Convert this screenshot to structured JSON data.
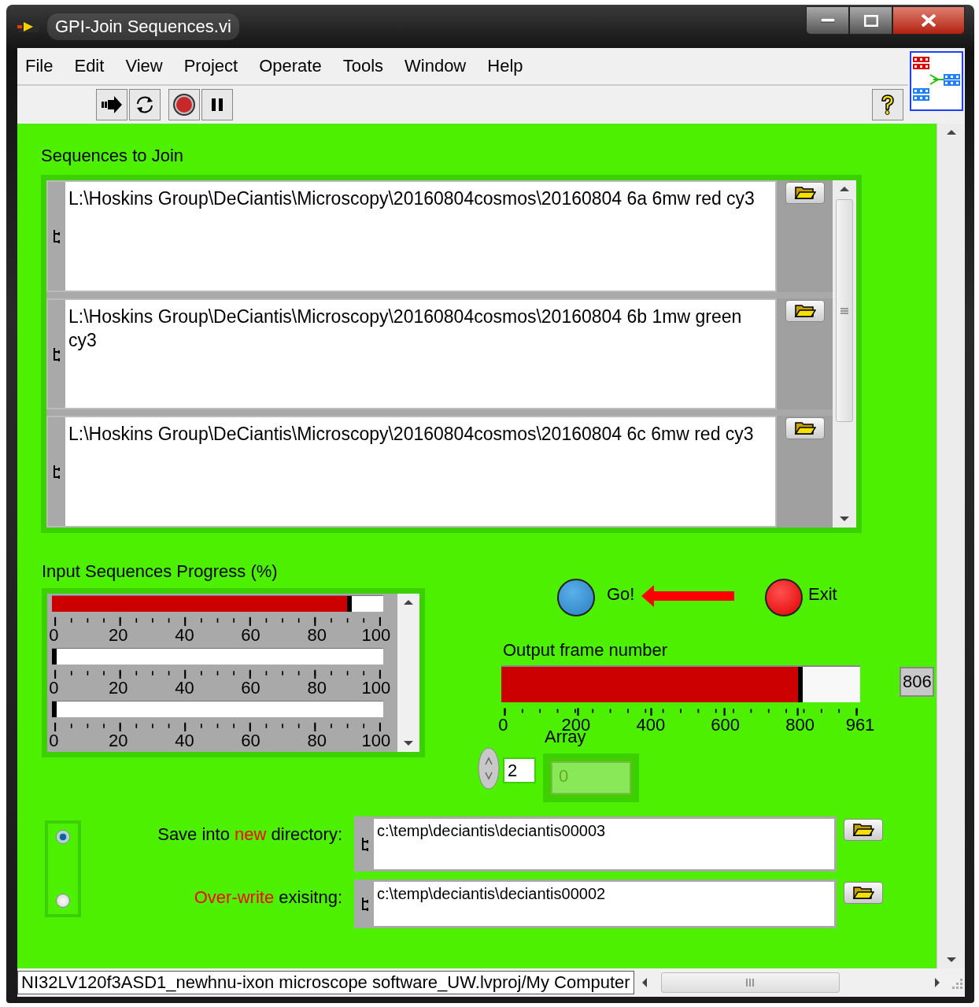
{
  "window": {
    "title": "GPI-Join Sequences.vi"
  },
  "menu": [
    {
      "label": "File"
    },
    {
      "label": "Edit"
    },
    {
      "label": "View"
    },
    {
      "label": "Project"
    },
    {
      "label": "Operate"
    },
    {
      "label": "Tools"
    },
    {
      "label": "Window"
    },
    {
      "label": "Help"
    }
  ],
  "sequences": {
    "label": "Sequences to Join",
    "items": [
      {
        "path": "L:\\Hoskins Group\\DeCiantis\\Microscopy\\20160804cosmos\\20160804 6a 6mw red cy3"
      },
      {
        "path": "L:\\Hoskins Group\\DeCiantis\\Microscopy\\20160804cosmos\\20160804 6b 1mw green cy3"
      },
      {
        "path": "L:\\Hoskins Group\\DeCiantis\\Microscopy\\20160804cosmos\\20160804 6c 6mw red cy3"
      }
    ]
  },
  "progress": {
    "label": "Input Sequences Progress (%)",
    "bars": [
      {
        "level": 0.89,
        "scale": [
          "0",
          "20",
          "40",
          "60",
          "80",
          "100"
        ]
      },
      {
        "level": 0,
        "scale": [
          "0",
          "20",
          "40",
          "60",
          "80",
          "100"
        ]
      },
      {
        "level": 0,
        "scale": [
          "0",
          "20",
          "40",
          "60",
          "80",
          "100"
        ]
      }
    ]
  },
  "go_button": {
    "label": "Go!"
  },
  "exit_button": {
    "label": "Exit"
  },
  "output_frame": {
    "label": "Output frame number",
    "level": 0.839,
    "scale": [
      "0",
      "200",
      "400",
      "600",
      "800",
      "961"
    ],
    "value": "806"
  },
  "array": {
    "label": "Array",
    "index": "2",
    "element": "0",
    "disabled": true
  },
  "destination": {
    "options": [
      {
        "label_parts": [
          {
            "text": "Save into ",
            "red": false
          },
          {
            "text": "new",
            "red": true
          },
          {
            "text": " directory:",
            "red": false
          }
        ],
        "path": "c:\\temp\\deciantis\\deciantis00003",
        "selected": true
      },
      {
        "label_parts": [
          {
            "text": "Over-write",
            "red": true
          },
          {
            "text": " exisitng:",
            "red": false
          }
        ],
        "path": "c:\\temp\\deciantis\\deciantis00002",
        "selected": false
      }
    ]
  },
  "status_bar": {
    "context": "NI32LV120f3ASD1_newhnu-ixon microscope software_UW.lvproj/My Computer"
  }
}
